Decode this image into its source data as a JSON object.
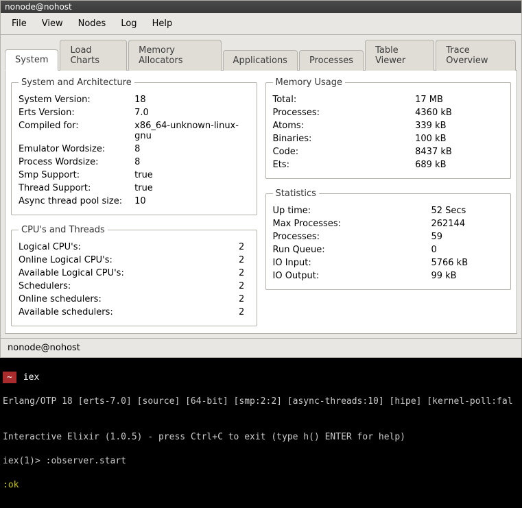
{
  "window": {
    "title": "nonode@nohost"
  },
  "menubar": [
    "File",
    "View",
    "Nodes",
    "Log",
    "Help"
  ],
  "tabs": [
    "System",
    "Load Charts",
    "Memory Allocators",
    "Applications",
    "Processes",
    "Table Viewer",
    "Trace Overview"
  ],
  "active_tab": 0,
  "groups": {
    "sys_arch": {
      "legend": "System and Architecture",
      "rows": [
        [
          "System Version:",
          "18"
        ],
        [
          "Erts Version:",
          "7.0"
        ],
        [
          "Compiled for:",
          "x86_64-unknown-linux-gnu"
        ],
        [
          "Emulator Wordsize:",
          "8"
        ],
        [
          "Process Wordsize:",
          "8"
        ],
        [
          "Smp Support:",
          "true"
        ],
        [
          "Thread Support:",
          "true"
        ],
        [
          "Async thread pool size:",
          "10"
        ]
      ]
    },
    "cpus": {
      "legend": "CPU's and Threads",
      "rows": [
        [
          "Logical CPU's:",
          "2"
        ],
        [
          "Online Logical CPU's:",
          "2"
        ],
        [
          "Available Logical CPU's:",
          "2"
        ],
        [
          "Schedulers:",
          "2"
        ],
        [
          "Online schedulers:",
          "2"
        ],
        [
          "Available schedulers:",
          "2"
        ]
      ]
    },
    "memory": {
      "legend": "Memory Usage",
      "rows": [
        [
          "Total:",
          "17 MB"
        ],
        [
          "Processes:",
          "4360 kB"
        ],
        [
          "Atoms:",
          "339 kB"
        ],
        [
          "Binaries:",
          "100 kB"
        ],
        [
          "Code:",
          "8437 kB"
        ],
        [
          "Ets:",
          "689 kB"
        ]
      ]
    },
    "stats": {
      "legend": "Statistics",
      "rows": [
        [
          "Up time:",
          "52 Secs"
        ],
        [
          "Max Processes:",
          "262144"
        ],
        [
          "Processes:",
          "59"
        ],
        [
          "Run Queue:",
          "0"
        ],
        [
          "IO Input:",
          "5766 kB"
        ],
        [
          "IO Output:",
          "99 kB"
        ]
      ]
    }
  },
  "statusbar": "nonode@nohost",
  "terminal": {
    "tab_home": "~",
    "tab_active": "iex",
    "line1": "Erlang/OTP 18 [erts-7.0] [source] [64-bit] [smp:2:2] [async-threads:10] [hipe] [kernel-poll:fal",
    "blank": "",
    "line2": "Interactive Elixir (1.0.5) - press Ctrl+C to exit (type h() ENTER for help)",
    "line3": "iex(1)> :observer.start",
    "line4": ":ok"
  }
}
